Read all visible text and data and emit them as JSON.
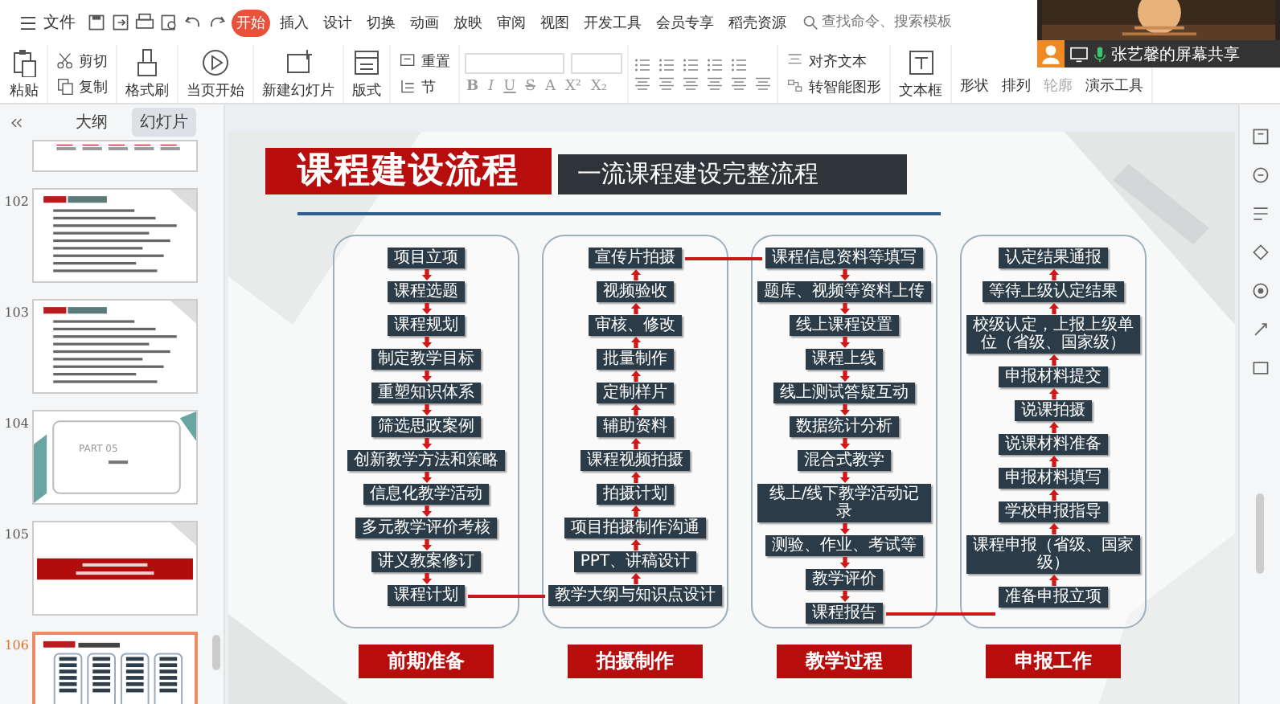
{
  "menu": {
    "file": "文件",
    "tabs": [
      {
        "label": "开始",
        "selected": true
      },
      {
        "label": "插入",
        "selected": false
      },
      {
        "label": "设计",
        "selected": false
      },
      {
        "label": "切换",
        "selected": false
      },
      {
        "label": "动画",
        "selected": false
      },
      {
        "label": "放映",
        "selected": false
      },
      {
        "label": "审阅",
        "selected": false
      },
      {
        "label": "视图",
        "selected": false
      },
      {
        "label": "开发工具",
        "selected": false
      },
      {
        "label": "会员专享",
        "selected": false
      },
      {
        "label": "稻壳资源",
        "selected": false
      }
    ],
    "search": {
      "placeholder": "查找命令、搜索模板"
    }
  },
  "ribbon": [
    {
      "kind": "big",
      "label": "粘贴"
    },
    {
      "kind": "stack",
      "items": [
        {
          "label": "剪切"
        },
        {
          "label": "复制"
        }
      ]
    },
    {
      "kind": "big",
      "label": "格式刷"
    },
    {
      "kind": "big",
      "label": "当页开始"
    },
    {
      "kind": "big",
      "label": "新建幻灯片"
    },
    {
      "kind": "big",
      "label": "版式"
    },
    {
      "kind": "stack",
      "items": [
        {
          "label": "重置"
        },
        {
          "label": "节"
        }
      ]
    },
    {
      "kind": "font",
      "format": [
        "B",
        "I",
        "U",
        "S",
        "A",
        "X²",
        "X₂"
      ]
    },
    {
      "kind": "paragraph"
    },
    {
      "kind": "stack",
      "items": [
        {
          "label": "对齐文本"
        },
        {
          "label": "转智能图形"
        }
      ]
    },
    {
      "kind": "big",
      "label": "文本框"
    },
    {
      "kind": "small",
      "items": [
        {
          "label": "形状",
          "disabled": false
        },
        {
          "label": "排列",
          "disabled": false
        },
        {
          "label": "轮廓",
          "disabled": true
        },
        {
          "label": "演示工具",
          "disabled": false
        }
      ]
    }
  ],
  "screen_share": {
    "label": "张艺馨的屏幕共享"
  },
  "panel": {
    "tabs": [
      {
        "label": "大纲",
        "selected": false
      },
      {
        "label": "幻灯片",
        "selected": true
      }
    ],
    "slides": [
      {
        "kind": "table",
        "selected": false
      },
      {
        "number": "102",
        "kind": "list",
        "selected": false
      },
      {
        "number": "103",
        "kind": "list",
        "selected": false
      },
      {
        "number": "104",
        "kind": "part",
        "part": "PART 05",
        "selected": false
      },
      {
        "number": "105",
        "kind": "banner",
        "selected": false
      },
      {
        "number": "106",
        "kind": "flow",
        "selected": true
      }
    ]
  },
  "slide": {
    "title": "课程建设流程",
    "subtitle": "一流课程建设完整流程",
    "columns": [
      {
        "label": "前期准备",
        "flow_up": false,
        "steps": [
          "项目立项",
          "课程选题",
          "课程规划",
          "制定教学目标",
          "重塑知识体系",
          "筛选思政案例",
          "创新教学方法和策略",
          "信息化教学活动",
          "多元教学评价考核",
          "讲义教案修订",
          "课程计划"
        ]
      },
      {
        "label": "拍摄制作",
        "flow_up": true,
        "steps": [
          "宣传片拍摄",
          "视频验收",
          "审核、修改",
          "批量制作",
          "定制样片",
          "辅助资料",
          "课程视频拍摄",
          "拍摄计划",
          "项目拍摄制作沟通",
          "PPT、讲稿设计",
          "教学大纲与知识点设计"
        ]
      },
      {
        "label": "教学过程",
        "flow_up": false,
        "steps": [
          "课程信息资料等填写",
          "题库、视频等资料上传",
          "线上课程设置",
          "课程上线",
          "线上测试答疑互动",
          "数据统计分析",
          "混合式教学",
          "线上/线下教学活动记录",
          "测验、作业、考试等",
          "教学评价",
          "课程报告"
        ]
      },
      {
        "label": "申报工作",
        "flow_up": true,
        "steps": [
          "认定结果通报",
          "等待上级认定结果",
          "校级认定，上报上级单位（省级、国家级）",
          "申报材料提交",
          "说课拍摄",
          "说课材料准备",
          "申报材料填写",
          "学校申报指导",
          "课程申报（省级、国家级）",
          "准备申报立项"
        ]
      }
    ]
  }
}
